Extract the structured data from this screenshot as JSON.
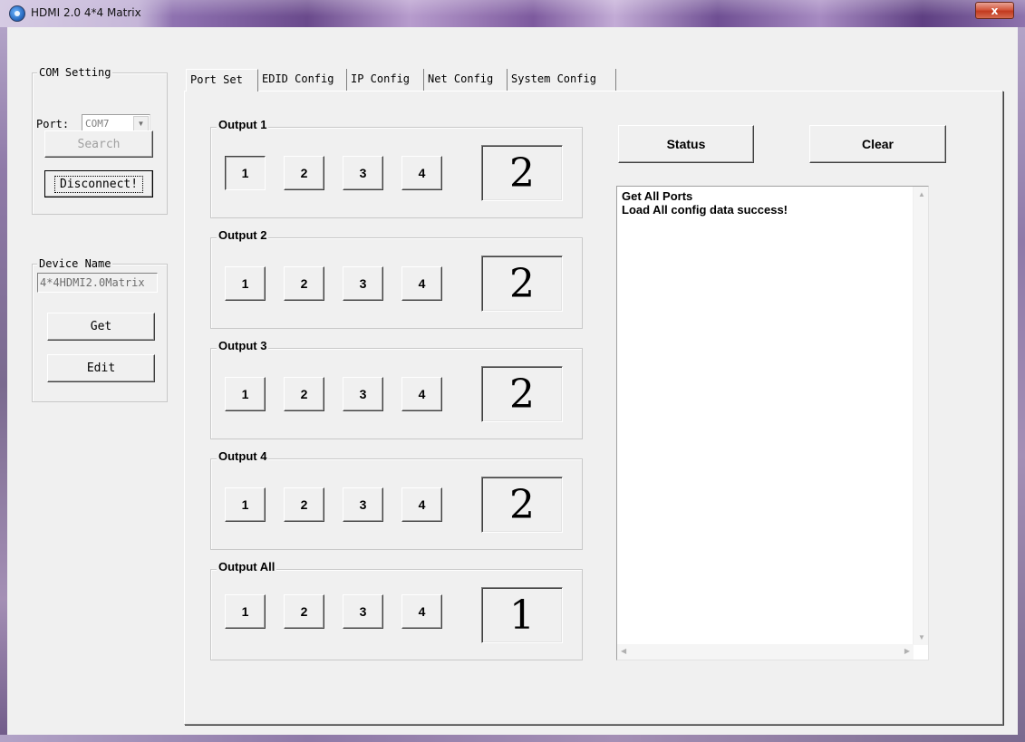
{
  "window": {
    "title": "HDMI 2.0 4*4 Matrix",
    "close_label": "x"
  },
  "com_setting": {
    "label": "COM Setting",
    "port_label": "Port:",
    "port_value": "COM7",
    "search_label": "Search",
    "disconnect_label": "Disconnect!"
  },
  "device_name": {
    "label": "Device Name",
    "value": "4*4HDMI2.0Matrix",
    "get_label": "Get",
    "edit_label": "Edit"
  },
  "tabs": [
    "Port Set",
    "EDID Config",
    "IP Config",
    "Net Config",
    "System Config"
  ],
  "outputs": [
    {
      "label": "Output 1",
      "buttons": [
        "1",
        "2",
        "3",
        "4"
      ],
      "current": "2"
    },
    {
      "label": "Output 2",
      "buttons": [
        "1",
        "2",
        "3",
        "4"
      ],
      "current": "2"
    },
    {
      "label": "Output 3",
      "buttons": [
        "1",
        "2",
        "3",
        "4"
      ],
      "current": "2"
    },
    {
      "label": "Output 4",
      "buttons": [
        "1",
        "2",
        "3",
        "4"
      ],
      "current": "2"
    },
    {
      "label": "Output All",
      "buttons": [
        "1",
        "2",
        "3",
        "4"
      ],
      "current": "1"
    }
  ],
  "actions": {
    "status_label": "Status",
    "clear_label": "Clear"
  },
  "log": {
    "lines": [
      "Get All Ports",
      "Load All config data success!"
    ]
  },
  "colors": {
    "titlebar_accent": "#6a4a8c",
    "close_button": "#c23a1f",
    "window_bg": "#f0f0f0"
  }
}
